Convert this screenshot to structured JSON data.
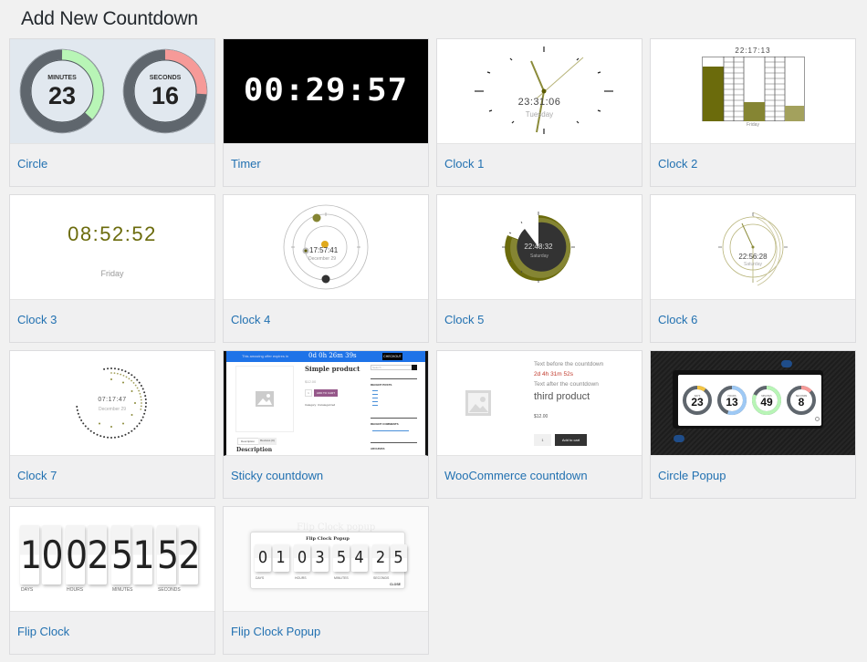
{
  "page": {
    "title": "Add New Countdown"
  },
  "cards": [
    {
      "label": "Circle",
      "preview": {
        "minutes_label": "MINUTES",
        "minutes": "23",
        "seconds_label": "SECONDS",
        "seconds": "16",
        "minutes_color": "#b8f5b6",
        "seconds_color": "#f69a98",
        "ring_color": "#5f666d",
        "bg": "#e1e8ef"
      }
    },
    {
      "label": "Timer",
      "preview": {
        "time": "00:29:57"
      }
    },
    {
      "label": "Clock 1",
      "preview": {
        "time": "23:31:06",
        "day": "Tuesday"
      }
    },
    {
      "label": "Clock 2",
      "preview": {
        "time": "22:17:13",
        "day": "Friday"
      }
    },
    {
      "label": "Clock 3",
      "preview": {
        "time": "08:52:52",
        "day": "Friday",
        "accent": "#6b6b0c"
      }
    },
    {
      "label": "Clock 4",
      "preview": {
        "time": "17:57:41",
        "date": "December 29"
      }
    },
    {
      "label": "Clock 5",
      "preview": {
        "time": "22:48:32",
        "day": "Saturday"
      }
    },
    {
      "label": "Clock 6",
      "preview": {
        "time": "22:56:28",
        "day": "Saturday"
      }
    },
    {
      "label": "Clock 7",
      "preview": {
        "time": "07:17:47",
        "date": "December 29"
      }
    },
    {
      "label": "Sticky countdown",
      "preview": {
        "bar_text": "This amazing offer expires in",
        "countdown": "0d 0h 26m 39s",
        "checkout": "CHECKOUT",
        "product_title": "Simple product",
        "price": "$12.00",
        "qty": "1",
        "add_to_cart": "ADD TO CART",
        "category": "Category: Uncategorized",
        "tab_description": "Description",
        "tab_reviews": "Reviews (0)",
        "section_heading": "Description",
        "search_placeholder": "Search …",
        "recent_posts": "RECENT POSTS",
        "recent_comments": "RECENT COMMENTS",
        "archives": "ARCHIVES",
        "bar_color": "#1e73e8"
      }
    },
    {
      "label": "WooCommerce countdown",
      "preview": {
        "before": "Text before the countdown",
        "countdown": "2d 4h 31m 52s",
        "after": "Text after the countdown",
        "product": "third product",
        "price": "$12.00",
        "qty": "1",
        "add_to_cart": "Add to cart"
      }
    },
    {
      "label": "Circle Popup",
      "preview": {
        "units": [
          {
            "label": "DAYS",
            "value": "23",
            "color": "#f4c542"
          },
          {
            "label": "HOURS",
            "value": "13",
            "color": "#9ec9f5"
          },
          {
            "label": "MINUTES",
            "value": "49",
            "color": "#b8f5b6"
          },
          {
            "label": "SECONDS",
            "value": "8",
            "color": "#f69a98"
          }
        ]
      }
    },
    {
      "label": "Flip Clock",
      "preview": {
        "digits": [
          "1",
          "0",
          "0",
          "2",
          "5",
          "1",
          "5",
          "2"
        ],
        "units": [
          "DAYS",
          "HOURS",
          "MINUTES",
          "SECONDS"
        ]
      }
    },
    {
      "label": "Flip Clock Popup",
      "preview": {
        "bg_title": "Flip Clock popup",
        "title": "Flip Clock Popup",
        "digits": [
          "0",
          "1",
          "0",
          "3",
          "5",
          "4",
          "2",
          "5"
        ],
        "units": [
          "DAYS",
          "HOURS",
          "MINUTES",
          "SECONDS"
        ],
        "close": "CLOSE"
      }
    }
  ]
}
